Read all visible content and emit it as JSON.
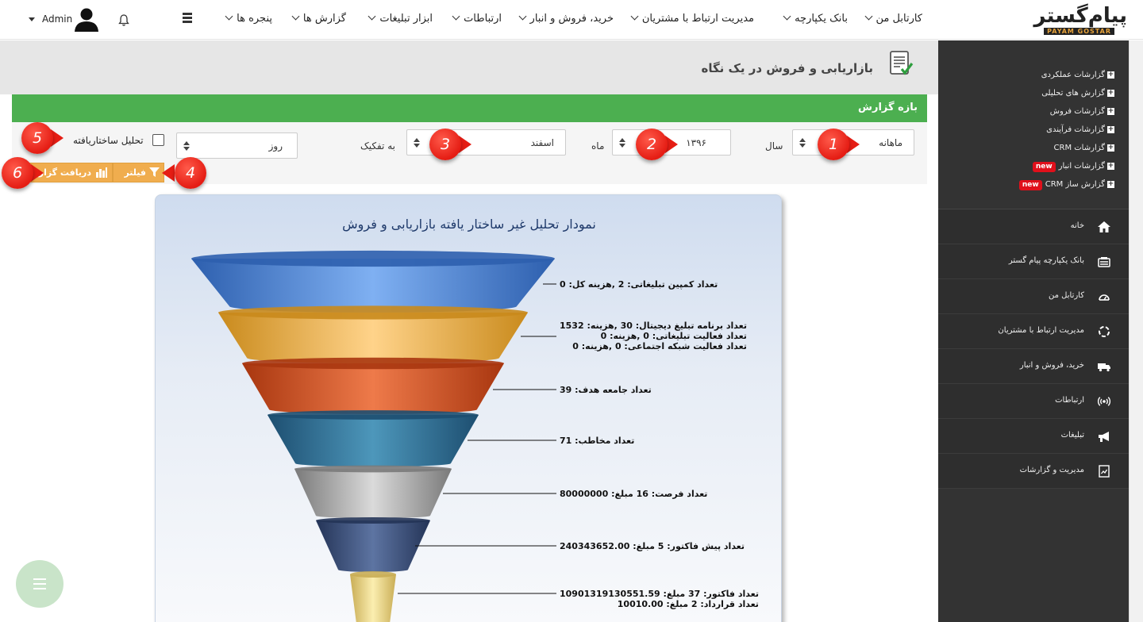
{
  "brand": {
    "logo_main": "پیام‌گستر",
    "logo_sub": "PAYAM GOSTAR"
  },
  "topnav": {
    "items": [
      {
        "label": "کارتابل من"
      },
      {
        "label": "بانک یکپارچه"
      },
      {
        "label": "مدیریت ارتباط با مشتریان"
      },
      {
        "label": "خرید، فروش و انبار"
      },
      {
        "label": "ارتباطات"
      },
      {
        "label": "ابزار تبلیغات"
      },
      {
        "label": "گزارش ها"
      },
      {
        "label": "پنجره ها"
      }
    ],
    "user": "Admin"
  },
  "sidebar": {
    "reports": [
      {
        "label": "گزارشات عملکردی",
        "new": ""
      },
      {
        "label": "گزارش های تحلیلی",
        "new": ""
      },
      {
        "label": "گزارشات فروش",
        "new": ""
      },
      {
        "label": "گزارشات فرآیندی",
        "new": ""
      },
      {
        "label": "گزارشات CRM",
        "new": ""
      },
      {
        "label": "گزارشات انبار",
        "new": "new"
      },
      {
        "label": "گزارش ساز CRM",
        "new": "new"
      }
    ],
    "nav": [
      {
        "label": "خانه",
        "icon": "home-icon"
      },
      {
        "label": "بانک یکپارچه پیام گستر",
        "icon": "database-icon"
      },
      {
        "label": "کارتابل من",
        "icon": "dashboard-icon"
      },
      {
        "label": "مدیریت ارتباط با مشتریان",
        "icon": "crm-icon"
      },
      {
        "label": "خرید، فروش و انبار",
        "icon": "truck-icon"
      },
      {
        "label": "ارتباطات",
        "icon": "broadcast-icon"
      },
      {
        "label": "تبلیغات",
        "icon": "megaphone-icon"
      },
      {
        "label": "مدیریت و گزارشات",
        "icon": "report-icon"
      }
    ]
  },
  "page": {
    "title": "بازاریابی و فروش در یک نگاه"
  },
  "period": {
    "title": "بازه گزارش",
    "period_type": "ماهانه",
    "year_label": "سال",
    "year_value": "۱۳۹۶",
    "month_label": "ماه",
    "month_value": "اسفند",
    "breakdown_label": "به تفکیک",
    "breakdown_value": "روز",
    "unstructured_label": "تحلیل ساختاریافته",
    "filter_btn": "فیلتر",
    "download_btn": "دریافت گزارش"
  },
  "markers": [
    "1",
    "2",
    "3",
    "4",
    "5",
    "6"
  ],
  "colors": {
    "accent_green": "#4caf50",
    "btn_orange": "#f0ad4e",
    "marker_red": "#e51d14",
    "sidebar_dark": "#333333"
  },
  "chart_data": {
    "type": "funnel",
    "title": "نمودار تحلیل غیر ساختار یافته بازاریابی و فروش",
    "stages": [
      {
        "label": "تعداد کمپین تبلیغاتی: 2 ,هزینه کل: 0"
      },
      {
        "label": "تعداد برنامه تبلیغ دیجیتال: 30 ,هزینه: 1532\nتعداد فعالیت تبلیغاتی: 0 ,هزینه: 0\nتعداد فعالیت شبکه اجتماعی: 0 ,هزینه: 0"
      },
      {
        "label": "تعداد جامعه هدف: 39"
      },
      {
        "label": "تعداد مخاطب: 71"
      },
      {
        "label": "تعداد فرصت: 16 مبلغ: 80000000"
      },
      {
        "label": "تعداد پیش فاکتور: 5 مبلغ: 240343652.00"
      },
      {
        "label": "تعداد فاکتور: 37 مبلغ: 10901319130551.59\nتعداد قرارداد: 2 مبلغ: 10010.00"
      }
    ]
  }
}
